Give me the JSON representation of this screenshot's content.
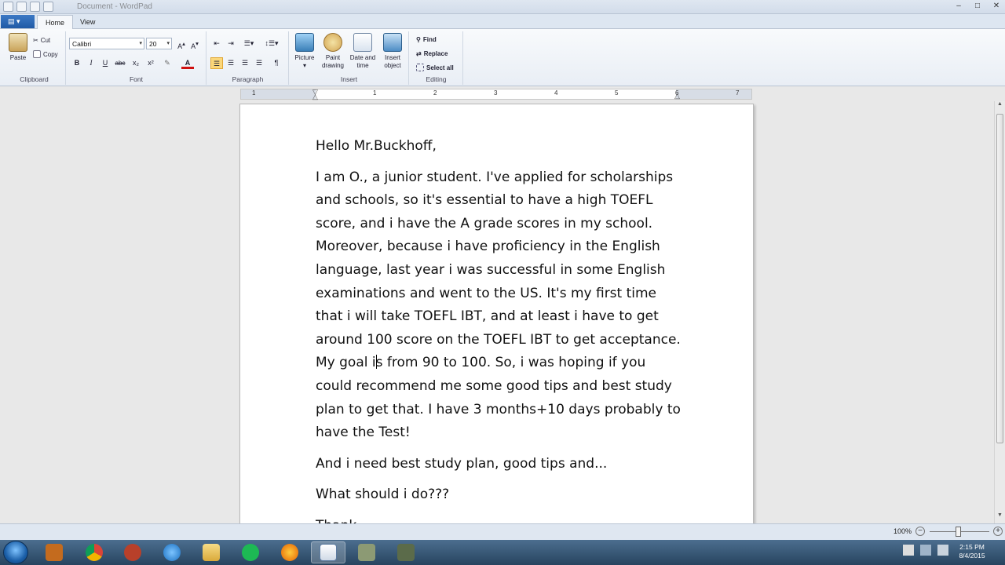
{
  "window": {
    "title": "Document - WordPad",
    "controls": [
      "–",
      "□",
      "✕"
    ]
  },
  "ribbon": {
    "file_tab_icon": "menu-icon",
    "tabs": [
      {
        "label": "Home",
        "active": true
      },
      {
        "label": "View",
        "active": false
      }
    ],
    "clipboard": {
      "paste_label": "Paste",
      "cut_label": "Cut",
      "copy_label": "Copy",
      "group_label": "Clipboard"
    },
    "font": {
      "family": "Calibri",
      "size": "20",
      "group_label": "Font",
      "buttons": [
        "B",
        "I",
        "U",
        "abc",
        "x₂",
        "x²",
        "✎",
        "A"
      ]
    },
    "paragraph": {
      "group_label": "Paragraph"
    },
    "insert": {
      "group_label": "Insert",
      "picture_label": "Picture",
      "paint_label_1": "Paint",
      "paint_label_2": "drawing",
      "datetime_label_1": "Date and",
      "datetime_label_2": "time",
      "object_label_1": "Insert",
      "object_label_2": "object"
    },
    "editing": {
      "group_label": "Editing",
      "find_label": "Find",
      "replace_label": "Replace",
      "select_all_label": "Select all"
    }
  },
  "ruler": {
    "numbers": [
      "1",
      "1",
      "2",
      "3",
      "4",
      "5",
      "6",
      "7"
    ]
  },
  "document": {
    "greeting": "Hello Mr.Buckhoff,",
    "body_before_caret": "I am O., a junior student. I've applied for scholarships and schools, so it's essential to have a high TOEFL score, and i have the A grade scores in my school. Moreover, because i have proficiency in the English language, last year i was successful in some English examinations and went to the US. It's my first time that i will take TOEFL IBT, and at least i have to get around 100 score on the TOEFL IBT to get acceptance. My goal i",
    "body_after_caret": "s from 90 to 100. So, i was hoping if you could recommend me some good tips and  best study plan to get that. I have 3 months+10 days probably to have the Test!",
    "line3": "And i need best study plan, good tips and...",
    "line4": "What should i do???",
    "line5": "Thank"
  },
  "status": {
    "zoom": "100%"
  },
  "taskbar": {
    "apps": [
      "media-icon",
      "chrome-icon",
      "app-icon",
      "ie-icon",
      "explorer-icon",
      "spotify-icon",
      "firefox-icon",
      "wordpad-icon",
      "app2-icon",
      "app3-icon"
    ],
    "time": "2:15 PM",
    "date": "8/4/2015"
  }
}
